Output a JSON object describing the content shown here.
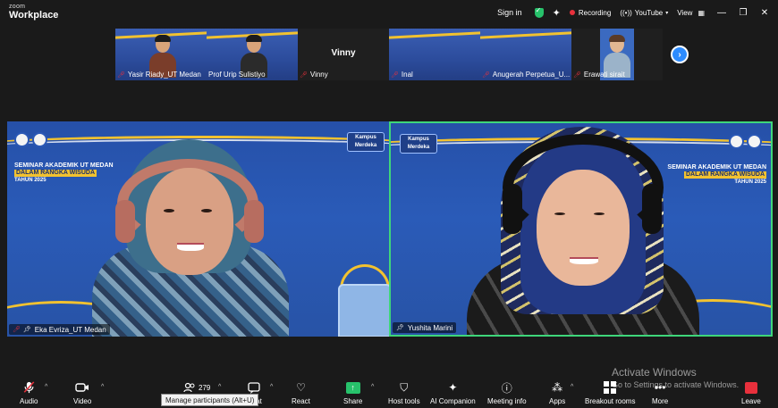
{
  "app": {
    "brand_small": "zoom",
    "brand_big": "Workplace",
    "sign_in": "Sign in",
    "recording": "Recording",
    "youtube": "YouTube",
    "view": "View",
    "icons": [
      "shield-check-icon",
      "sparkle-icon",
      "minimize-icon",
      "restore-icon",
      "close-icon"
    ]
  },
  "thumbnails": [
    {
      "name": "Yasir Riady_UT Medan",
      "muted": true,
      "video": true
    },
    {
      "name": "Prof Urip Sulistiyo",
      "muted": false,
      "video": true
    },
    {
      "name": "Vinny",
      "muted": true,
      "video": false,
      "big_name": "Vinny"
    },
    {
      "name": "Inal",
      "muted": true,
      "video": true
    },
    {
      "name": "Anugerah Perpetua_U...",
      "muted": true,
      "video": true
    },
    {
      "name": "Erawati sirait",
      "muted": true,
      "video": true
    }
  ],
  "tiles": {
    "left": {
      "name": "Eka Evriza_UT Medan",
      "muted": true,
      "kampus_label": "Kampus Merdeka",
      "seminar_title": "SEMINAR AKADEMIK UT MEDAN",
      "seminar_sub": "DALAM RANGKA WISUDA",
      "seminar_year": "TAHUN 2025"
    },
    "right": {
      "name": "Yushita Marini",
      "muted": false,
      "active_speaker": true,
      "kampus_label": "Kampus Merdeka",
      "seminar_title": "SEMINAR AKADEMIK UT MEDAN",
      "seminar_sub": "DALAM RANGKA WISUDA",
      "seminar_year": "TAHUN 2025"
    }
  },
  "watermark": {
    "line1": "Activate Windows",
    "line2": "Go to Settings to activate Windows."
  },
  "toolbar": {
    "audio": "Audio",
    "video": "Video",
    "participants_count": "279",
    "chat": "Chat",
    "react": "React",
    "share": "Share",
    "host_tools": "Host tools",
    "ai_companion": "AI Companion",
    "meeting_info": "Meeting info",
    "apps": "Apps",
    "breakout_rooms": "Breakout rooms",
    "more": "More",
    "leave": "Leave",
    "tooltip": "Manage participants (Alt+U)"
  },
  "colors": {
    "accent_blue": "#2d8cff",
    "active_border": "#3ed67a",
    "record_red": "#e8303c",
    "banner_yellow": "#f2c230",
    "background_blue": "#2a5bb8"
  }
}
